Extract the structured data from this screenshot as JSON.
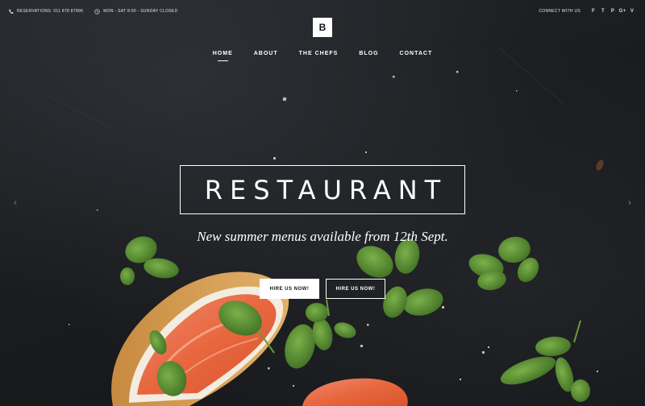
{
  "topbar": {
    "reservations": "RESERVATIONS: 011 878 87896",
    "hours": "MON - SAT 8:00 - SUNDAY CLOSED",
    "connect": "CONNECT WITH US",
    "social": [
      {
        "icon": "facebook-icon",
        "glyph": "f"
      },
      {
        "icon": "twitter-icon",
        "glyph": "t"
      },
      {
        "icon": "pinterest-icon",
        "glyph": "p"
      },
      {
        "icon": "google-plus-icon",
        "glyph": "g+"
      },
      {
        "icon": "vimeo-icon",
        "glyph": "v"
      }
    ]
  },
  "logo": {
    "letter": "B"
  },
  "nav": {
    "items": [
      {
        "label": "HOME",
        "active": true
      },
      {
        "label": "ABOUT",
        "active": false
      },
      {
        "label": "THE CHEFS",
        "active": false
      },
      {
        "label": "BLOG",
        "active": false
      },
      {
        "label": "CONTACT",
        "active": false
      }
    ]
  },
  "hero": {
    "title": "RESTAURANT",
    "subtitle": "New summer menus available from 12th Sept.",
    "primary_button": "HIRE US NOW!",
    "secondary_button": "HIRE US NOW!"
  },
  "slider": {
    "prev_icon": "chevron-left-icon",
    "next_icon": "chevron-right-icon",
    "prev_glyph": "‹",
    "next_glyph": "›"
  }
}
